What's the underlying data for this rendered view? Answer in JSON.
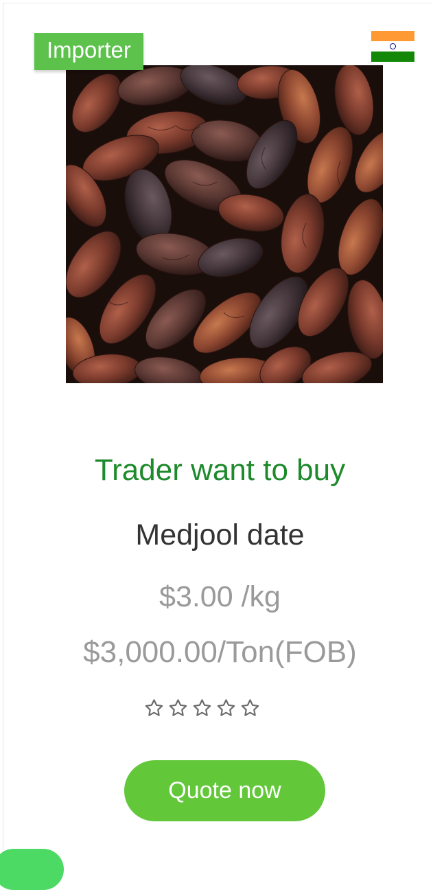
{
  "card": {
    "badge_label": "Importer",
    "flag_icon": "india-flag-icon",
    "image_alt": "Medjool dates",
    "headline": "Trader want to buy",
    "product_name": "Medjool date",
    "price_per_kg": "$3.00 /kg",
    "price_per_ton": "$3,000.00/Ton(FOB)",
    "rating": {
      "value": 0,
      "max": 5
    },
    "quote_button_label": "Quote now"
  },
  "colors": {
    "badge": "#5cc24c",
    "headline": "#1e8a2c",
    "button": "#62c83a",
    "float_tab": "#4cd964"
  }
}
